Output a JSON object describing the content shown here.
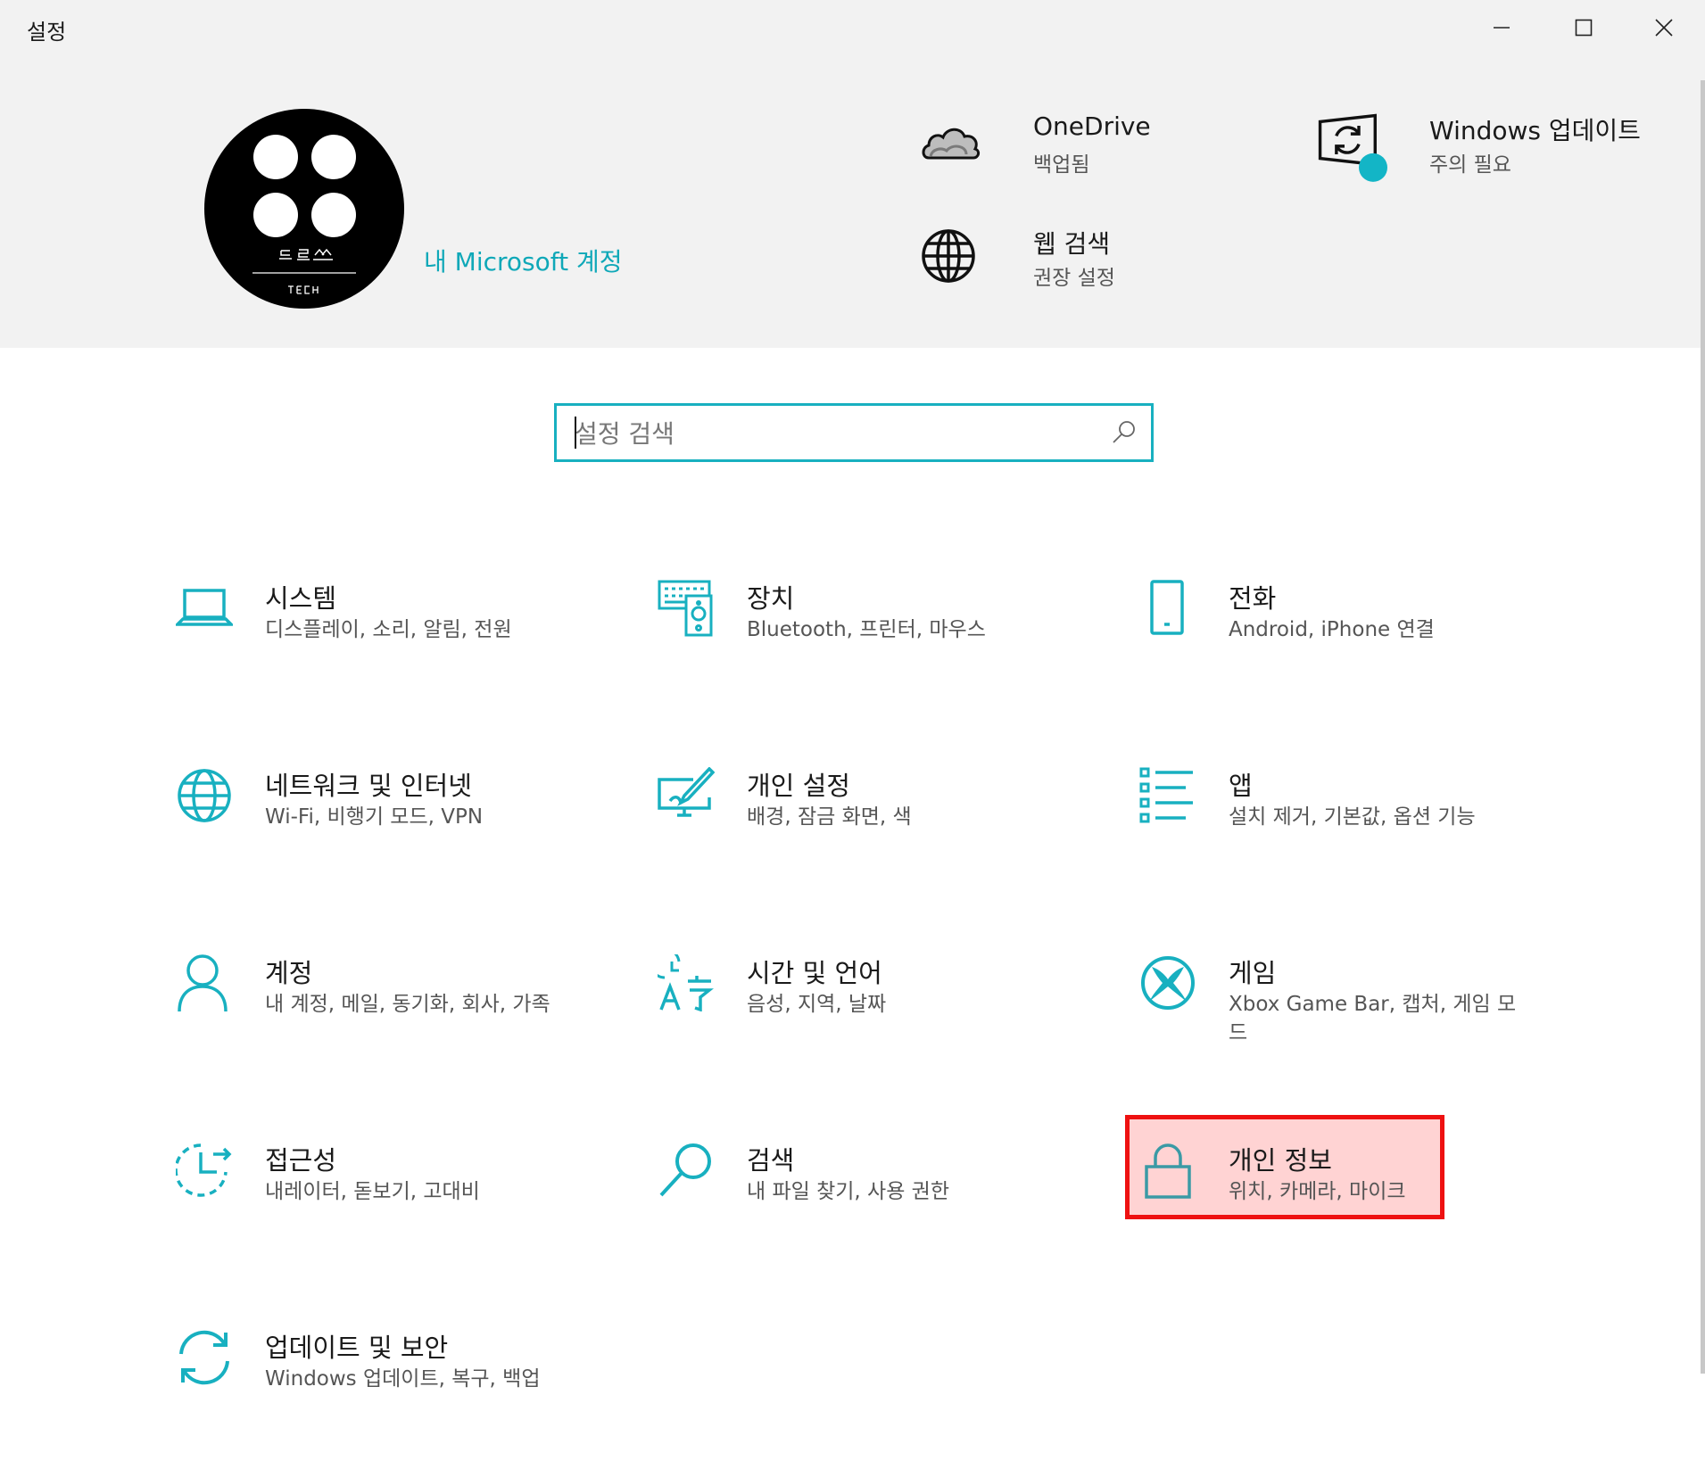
{
  "window": {
    "title": "설정"
  },
  "account": {
    "link_label": "내 Microsoft 계정"
  },
  "header_items": [
    {
      "title": "OneDrive",
      "subtitle": "백업됨"
    },
    {
      "title": "Windows 업데이트",
      "subtitle": "주의 필요"
    },
    {
      "title": "웹 검색",
      "subtitle": "권장 설정"
    }
  ],
  "search": {
    "placeholder": "설정 검색"
  },
  "tiles": [
    {
      "title": "시스템",
      "subtitle": "디스플레이, 소리, 알림, 전원"
    },
    {
      "title": "장치",
      "subtitle": "Bluetooth, 프린터, 마우스"
    },
    {
      "title": "전화",
      "subtitle": "Android, iPhone 연결"
    },
    {
      "title": "네트워크 및 인터넷",
      "subtitle": "Wi-Fi, 비행기 모드, VPN"
    },
    {
      "title": "개인 설정",
      "subtitle": "배경, 잠금 화면, 색"
    },
    {
      "title": "앱",
      "subtitle": "설치 제거, 기본값, 옵션 기능"
    },
    {
      "title": "계정",
      "subtitle": "내 계정, 메일, 동기화, 회사, 가족"
    },
    {
      "title": "시간 및 언어",
      "subtitle": "음성, 지역, 날짜"
    },
    {
      "title": "게임",
      "subtitle": "Xbox Game Bar, 캡처, 게임 모드"
    },
    {
      "title": "접근성",
      "subtitle": "내레이터, 돋보기, 고대비"
    },
    {
      "title": "검색",
      "subtitle": "내 파일 찾기, 사용 권한"
    },
    {
      "title": "개인 정보",
      "subtitle": "위치, 카메라, 마이크"
    },
    {
      "title": "업데이트 및 보안",
      "subtitle": "Windows 업데이트, 복구, 백업"
    }
  ],
  "colors": {
    "accent": "#18b0c0",
    "header_bg": "#f2f2f2",
    "highlight_border": "#ee1111",
    "highlight_fill": "#ffd3d3",
    "update_badge": "#13b5c6"
  }
}
